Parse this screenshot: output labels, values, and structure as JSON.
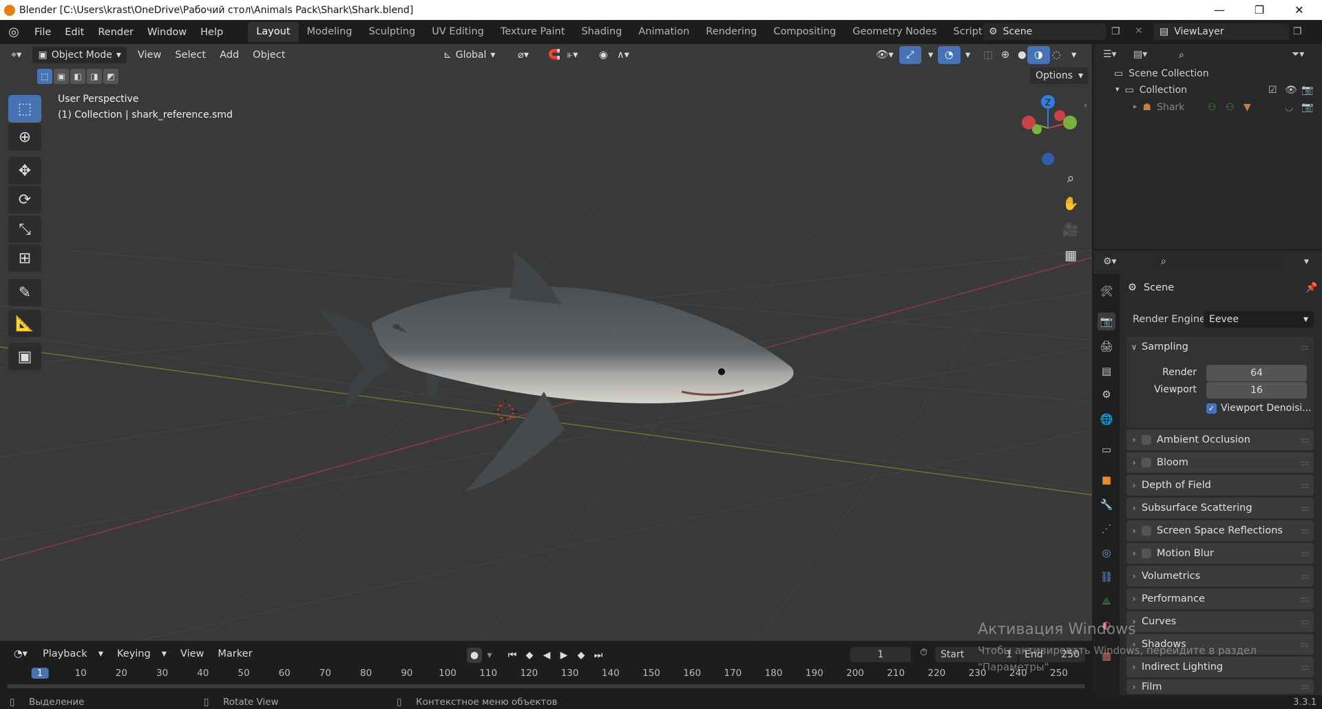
{
  "window": {
    "title": "Blender [C:\\Users\\krast\\OneDrive\\Рабочий стол\\Animals Pack\\Shark\\Shark.blend]",
    "minimize": "—",
    "maximize": "❐",
    "close": "✕"
  },
  "menus": [
    "File",
    "Edit",
    "Render",
    "Window",
    "Help"
  ],
  "workspaces": [
    {
      "label": "Layout",
      "active": true
    },
    {
      "label": "Modeling"
    },
    {
      "label": "Sculpting"
    },
    {
      "label": "UV Editing"
    },
    {
      "label": "Texture Paint"
    },
    {
      "label": "Shading"
    },
    {
      "label": "Animation"
    },
    {
      "label": "Rendering"
    },
    {
      "label": "Compositing"
    },
    {
      "label": "Geometry Nodes"
    },
    {
      "label": "Scripting"
    }
  ],
  "add_workspace": "+",
  "scene_name": "Scene",
  "view_layer": "ViewLayer",
  "viewport_header": {
    "mode": "Object Mode",
    "menus": [
      "View",
      "Select",
      "Add",
      "Object"
    ],
    "orientation": "Global",
    "options": "Options"
  },
  "viewport_info": {
    "line1": "User Perspective",
    "line2": "(1) Collection | shark_reference.smd"
  },
  "gizmo": {
    "z": "Z",
    "y": "Y",
    "x": "X"
  },
  "outliner": {
    "scene_collection": "Scene Collection",
    "collection": "Collection",
    "object": "Shark"
  },
  "properties": {
    "context": "Scene",
    "render_engine_label": "Render Engine",
    "render_engine": "Eevee",
    "sampling": {
      "title": "Sampling",
      "render_label": "Render",
      "render": "64",
      "viewport_label": "Viewport",
      "viewport": "16",
      "denoise": "Viewport Denoisi..."
    },
    "panels": [
      {
        "label": "Ambient Occlusion",
        "checkbox": true
      },
      {
        "label": "Bloom",
        "checkbox": true
      },
      {
        "label": "Depth of Field",
        "checkbox": false
      },
      {
        "label": "Subsurface Scattering",
        "checkbox": false
      },
      {
        "label": "Screen Space Reflections",
        "checkbox": true
      },
      {
        "label": "Motion Blur",
        "checkbox": true
      },
      {
        "label": "Volumetrics",
        "checkbox": false
      },
      {
        "label": "Performance",
        "checkbox": false
      },
      {
        "label": "Curves",
        "checkbox": false
      },
      {
        "label": "Shadows",
        "checkbox": false
      },
      {
        "label": "Indirect Lighting",
        "checkbox": false
      },
      {
        "label": "Film",
        "checkbox": false
      }
    ]
  },
  "timeline": {
    "menus": [
      "Playback",
      "Keying",
      "View",
      "Marker"
    ],
    "current_frame": "1",
    "start_label": "Start",
    "start": "1",
    "end_label": "End",
    "end": "250",
    "ticks": [
      "1",
      "10",
      "20",
      "30",
      "40",
      "50",
      "60",
      "70",
      "80",
      "90",
      "100",
      "110",
      "120",
      "130",
      "140",
      "150",
      "160",
      "170",
      "180",
      "190",
      "200",
      "210",
      "220",
      "230",
      "240",
      "250"
    ]
  },
  "watermark": {
    "line1": "Активация Windows",
    "line2": "Чтобы активировать Windows, перейдите в раздел",
    "line3": "\"Параметры\"."
  },
  "statusbar": {
    "select": "Выделение",
    "rotate": "Rotate View",
    "context_menu": "Контекстное меню объектов",
    "version": "3.3.1"
  },
  "colors": {
    "accent": "#4772b3",
    "x_axis": "#c9424a",
    "y_axis": "#7ab03d",
    "z_axis": "#2f7ee3",
    "blender_orange": "#e87d0d"
  }
}
